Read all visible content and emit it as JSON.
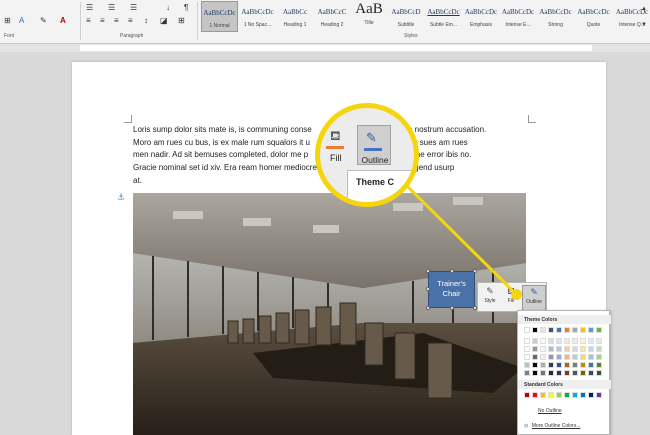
{
  "ribbon": {
    "groups": {
      "font": "Font",
      "paragraph": "Paragraph",
      "styles": "Styles"
    },
    "styles": [
      {
        "preview": "AaBbCcDc",
        "name": "1 Normal"
      },
      {
        "preview": "AaBbCcDc",
        "name": "1 No Spac..."
      },
      {
        "preview": "AaBbCc",
        "name": "Heading 1"
      },
      {
        "preview": "AaBbCcC",
        "name": "Heading 2"
      },
      {
        "preview": "AaB",
        "name": "Title"
      },
      {
        "preview": "AaBbCcD",
        "name": "Subtitle"
      },
      {
        "preview": "AaBbCcDc",
        "name": "Subtle Em..."
      },
      {
        "preview": "AaBbCcDc",
        "name": "Emphasis"
      },
      {
        "preview": "AaBbCcDc",
        "name": "Intense E..."
      },
      {
        "preview": "AaBbCcDc",
        "name": "Strong"
      },
      {
        "preview": "AaBbCcDc",
        "name": "Quote"
      },
      {
        "preview": "AaBbCcDc",
        "name": "Intense Q..."
      }
    ]
  },
  "document": {
    "lines": [
      "Loris sump dolor sits mate is, is communing conse",
      "Moro am rues cu bus, is ex male rum squalors it u",
      "men nadir. Ad sit bemuses completed, dolor me p",
      "Gracie nominal set id xiv. Era ream homer mediocre",
      "at."
    ],
    "lines_right": [
      "d has en nostrum accusation.",
      "a eke, re me sues am rues",
      "re. Doctor time error ibis no.",
      "mails erred, sad legend usurp"
    ]
  },
  "shape": {
    "text": "Trainer's Chair"
  },
  "mini_toolbar": {
    "style": "Style",
    "fill": "Fill",
    "outline": "Outline"
  },
  "dropdown": {
    "theme_colors": "Theme Colors",
    "standard_colors": "Standard Colors",
    "no_outline": "No Outline",
    "more_colors": "More Outline Colors...",
    "theme_row": [
      "#ffffff",
      "#000000",
      "#e7e6e6",
      "#44546a",
      "#4472c4",
      "#ed7d31",
      "#a5a5a5",
      "#ffc000",
      "#5b9bd5",
      "#70ad47"
    ],
    "standard_row": [
      "#c00000",
      "#ff0000",
      "#ffc000",
      "#ffff00",
      "#92d050",
      "#00b050",
      "#00b0f0",
      "#0070c0",
      "#002060",
      "#7030a0"
    ]
  },
  "zoom": {
    "fill": "Fill",
    "outline": "Outline",
    "theme": "Theme C"
  },
  "colors": {
    "callout": "#f5d60e",
    "shape": "#4a72a8",
    "fill_bar": "#ed7d31",
    "outline_bar": "#4472c4"
  }
}
